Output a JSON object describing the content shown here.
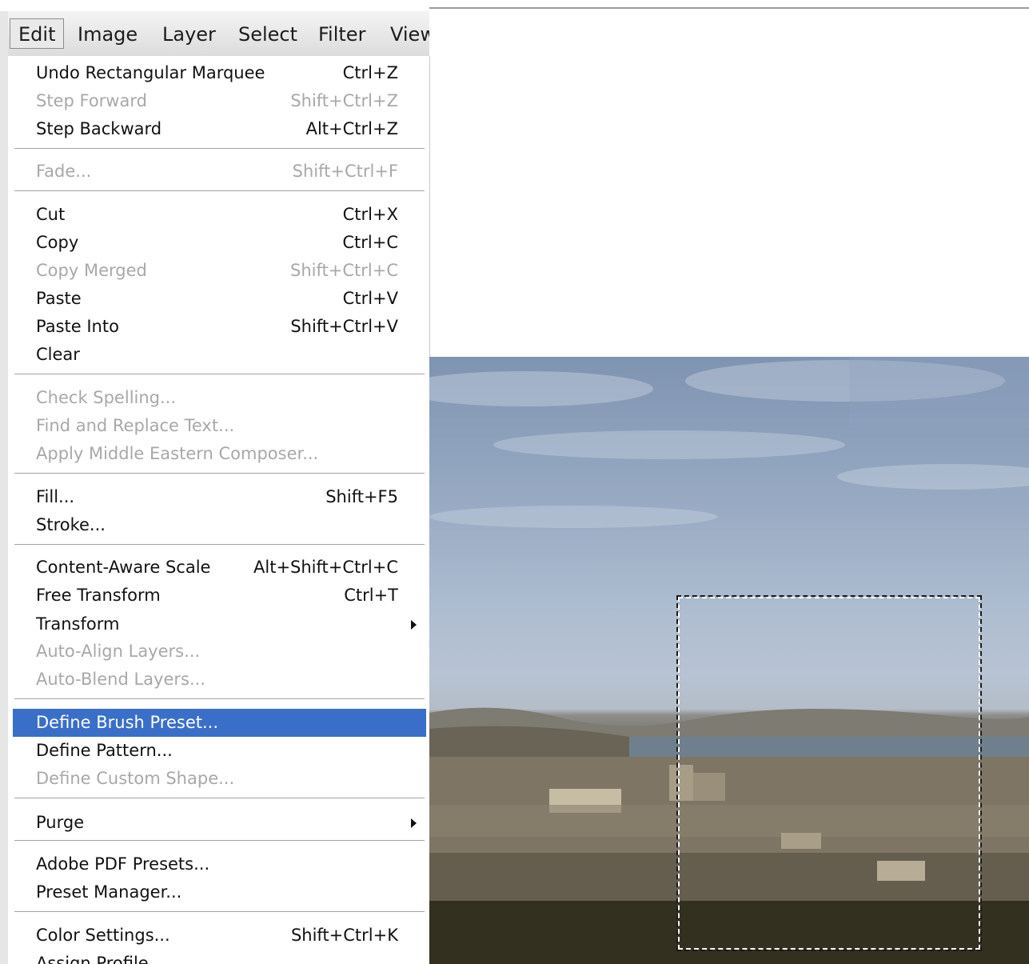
{
  "menubar": {
    "items": [
      "Edit",
      "Image",
      "Layer",
      "Select",
      "Filter",
      "View"
    ],
    "active": "Edit"
  },
  "edit_menu": {
    "items": [
      {
        "label": "Undo Rectangular Marquee",
        "shortcut": "Ctrl+Z",
        "enabled": true
      },
      {
        "label": "Step Forward",
        "shortcut": "Shift+Ctrl+Z",
        "enabled": false
      },
      {
        "label": "Step Backward",
        "shortcut": "Alt+Ctrl+Z",
        "enabled": true
      },
      {
        "label": "Fade...",
        "shortcut": "Shift+Ctrl+F",
        "enabled": false
      },
      {
        "label": "Cut",
        "shortcut": "Ctrl+X",
        "enabled": true
      },
      {
        "label": "Copy",
        "shortcut": "Ctrl+C",
        "enabled": true
      },
      {
        "label": "Copy Merged",
        "shortcut": "Shift+Ctrl+C",
        "enabled": false
      },
      {
        "label": "Paste",
        "shortcut": "Ctrl+V",
        "enabled": true
      },
      {
        "label": "Paste Into",
        "shortcut": "Shift+Ctrl+V",
        "enabled": true
      },
      {
        "label": "Clear",
        "shortcut": "",
        "enabled": true
      },
      {
        "label": "Check Spelling...",
        "shortcut": "",
        "enabled": false
      },
      {
        "label": "Find and Replace Text...",
        "shortcut": "",
        "enabled": false
      },
      {
        "label": "Apply Middle Eastern Composer...",
        "shortcut": "",
        "enabled": false
      },
      {
        "label": "Fill...",
        "shortcut": "Shift+F5",
        "enabled": true
      },
      {
        "label": "Stroke...",
        "shortcut": "",
        "enabled": true
      },
      {
        "label": "Content-Aware Scale",
        "shortcut": "Alt+Shift+Ctrl+C",
        "enabled": true
      },
      {
        "label": "Free Transform",
        "shortcut": "Ctrl+T",
        "enabled": true
      },
      {
        "label": "Transform",
        "shortcut": "",
        "enabled": true,
        "submenu": true
      },
      {
        "label": "Auto-Align Layers...",
        "shortcut": "",
        "enabled": false
      },
      {
        "label": "Auto-Blend Layers...",
        "shortcut": "",
        "enabled": false
      },
      {
        "label": "Define Brush Preset...",
        "shortcut": "",
        "enabled": true,
        "highlighted": true
      },
      {
        "label": "Define Pattern...",
        "shortcut": "",
        "enabled": true
      },
      {
        "label": "Define Custom Shape...",
        "shortcut": "",
        "enabled": false
      },
      {
        "label": "Purge",
        "shortcut": "",
        "enabled": true,
        "submenu": true
      },
      {
        "label": "Adobe PDF Presets...",
        "shortcut": "",
        "enabled": true
      },
      {
        "label": "Preset Manager...",
        "shortcut": "",
        "enabled": true
      },
      {
        "label": "Color Settings...",
        "shortcut": "Shift+Ctrl+K",
        "enabled": true
      },
      {
        "label": "Assign Profile...",
        "shortcut": "",
        "enabled": true
      }
    ]
  },
  "colors": {
    "highlight": "#3a6fc9",
    "disabled_text": "#a8a8a8"
  }
}
